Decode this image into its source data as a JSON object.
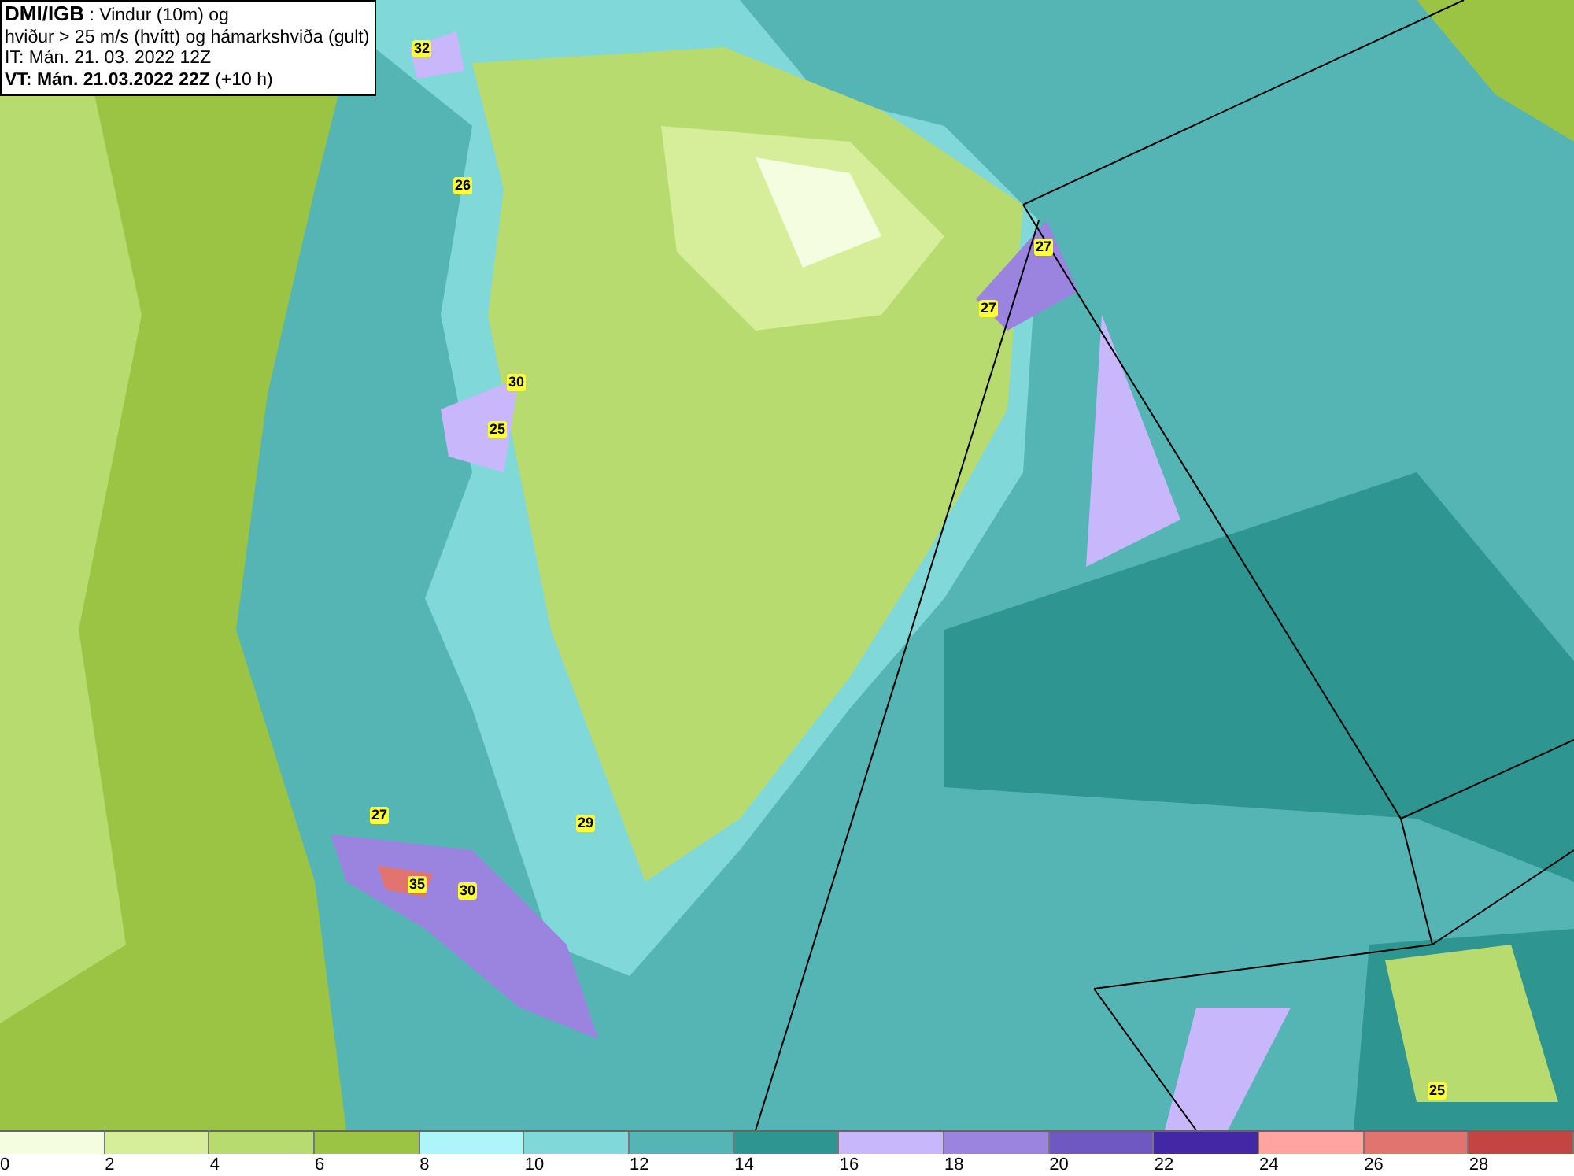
{
  "title_box": {
    "lines": [
      "**DMI/IGB** : Vindur (10m) og",
      "hviður > 25 m/s (hvítt) og hámarkshviða (gult)",
      "IT: Mán. 21. 03. 2022 12Z",
      "**VT: Mán. 21.03.2022 22Z** (+10 h)"
    ]
  },
  "gust_labels": [
    "32",
    "26",
    "30",
    "25",
    "27",
    "27",
    "27",
    "29",
    "35",
    "30",
    "25"
  ],
  "legend": [
    {
      "label": "0",
      "color": "#f5fde0"
    },
    {
      "label": "2",
      "color": "#d6ee9a"
    },
    {
      "label": "4",
      "color": "#b8db70"
    },
    {
      "label": "6",
      "color": "#9cc444"
    },
    {
      "label": "8",
      "color": "#aef5fa"
    },
    {
      "label": "10",
      "color": "#80d8d8"
    },
    {
      "label": "12",
      "color": "#55b5b5"
    },
    {
      "label": "14",
      "color": "#2e9590"
    },
    {
      "label": "16",
      "color": "#c8b8fb"
    },
    {
      "label": "18",
      "color": "#9a84e0"
    },
    {
      "label": "20",
      "color": "#7058c2"
    },
    {
      "label": "22",
      "color": "#4328a5"
    },
    {
      "label": "24",
      "color": "#ffa4a0"
    },
    {
      "label": "26",
      "color": "#e27470"
    },
    {
      "label": "28",
      "color": "#c44444"
    }
  ]
}
